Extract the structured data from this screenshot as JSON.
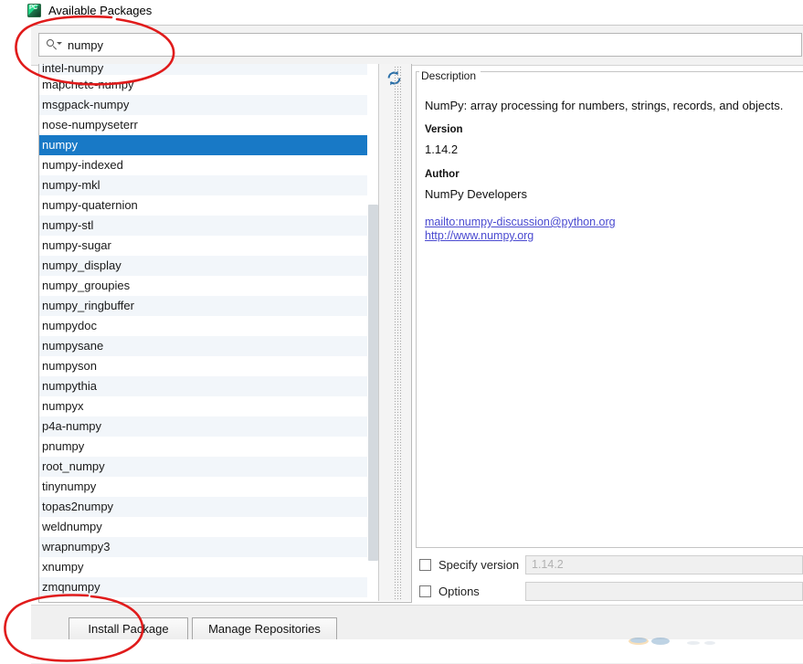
{
  "window": {
    "title": "Available Packages",
    "icon": "pycharm-icon",
    "icon_text": "PC"
  },
  "search": {
    "icon": "search-icon",
    "value": "numpy",
    "placeholder": ""
  },
  "list": {
    "refresh_icon": "refresh-icon",
    "selected": "numpy",
    "items": [
      "intel-numpy",
      "mapchete-numpy",
      "msgpack-numpy",
      "nose-numpyseterr",
      "numpy",
      "numpy-indexed",
      "numpy-mkl",
      "numpy-quaternion",
      "numpy-stl",
      "numpy-sugar",
      "numpy_display",
      "numpy_groupies",
      "numpy_ringbuffer",
      "numpydoc",
      "numpysane",
      "numpyson",
      "numpythia",
      "numpyx",
      "p4a-numpy",
      "pnumpy",
      "root_numpy",
      "tinynumpy",
      "topas2numpy",
      "weldnumpy",
      "wrapnumpy3",
      "xnumpy",
      "zmqnumpy"
    ]
  },
  "description": {
    "legend": "Description",
    "summary": "NumPy: array processing for numbers, strings, records, and objects.",
    "version_label": "Version",
    "version_value": "1.14.2",
    "author_label": "Author",
    "author_value": "NumPy Developers",
    "links": [
      "mailto:numpy-discussion@python.org",
      "http://www.numpy.org"
    ]
  },
  "options": {
    "specify_version_label": "Specify version",
    "specify_version_value": "1.14.2",
    "specify_version_checked": false,
    "options_label": "Options",
    "options_value": "",
    "options_checked": false
  },
  "buttons": {
    "install": "Install Package",
    "manage": "Manage Repositories"
  },
  "annotations": {
    "color": "#e01b1b",
    "search_highlight": "ellipse-around-search-field",
    "install_highlight": "ellipse-around-install-package-button"
  }
}
